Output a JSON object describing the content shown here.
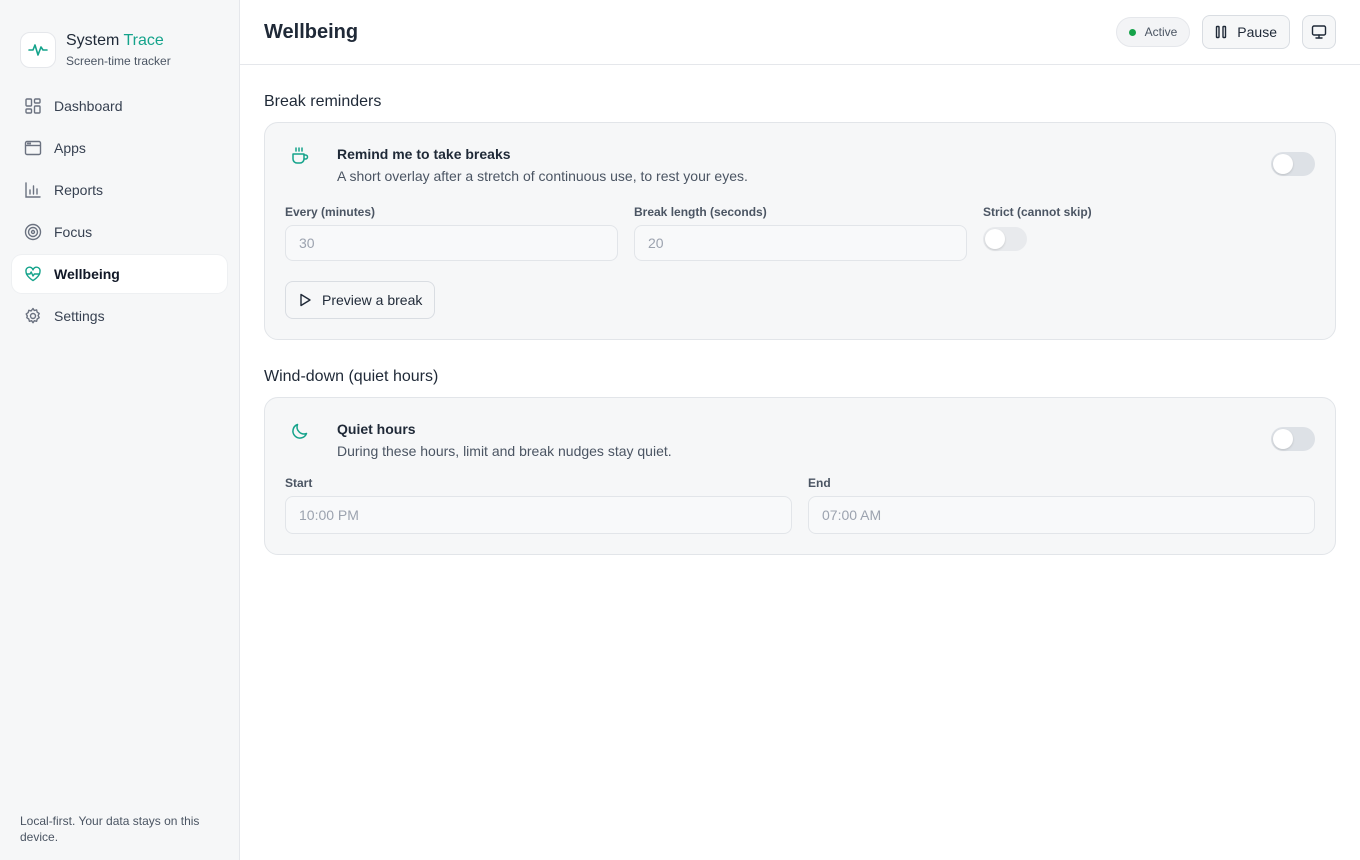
{
  "brand": {
    "name_part1": "System",
    "name_part2": "Trace",
    "subtitle": "Screen-time tracker",
    "accent_color": "#14a38b"
  },
  "sidebar": {
    "items": [
      {
        "label": "Dashboard",
        "icon": "dashboard-icon",
        "active": false
      },
      {
        "label": "Apps",
        "icon": "apps-window-icon",
        "active": false
      },
      {
        "label": "Reports",
        "icon": "bar-chart-icon",
        "active": false
      },
      {
        "label": "Focus",
        "icon": "target-icon",
        "active": false
      },
      {
        "label": "Wellbeing",
        "icon": "heart-pulse-icon",
        "active": true
      },
      {
        "label": "Settings",
        "icon": "gear-icon",
        "active": false
      }
    ],
    "footer": "Local-first. Your data stays on this device."
  },
  "header": {
    "title": "Wellbeing",
    "status": "Active",
    "status_color": "#16a34a",
    "pause_label": "Pause"
  },
  "break_section": {
    "title": "Break reminders",
    "card_title": "Remind me to take breaks",
    "card_desc": "A short overlay after a stretch of continuous use, to rest your eyes.",
    "enabled": false,
    "every_label": "Every (minutes)",
    "every_value": "30",
    "length_label": "Break length (seconds)",
    "length_value": "20",
    "strict_label": "Strict (cannot skip)",
    "strict_enabled": false,
    "preview_label": "Preview a break"
  },
  "quiet_section": {
    "title": "Wind-down (quiet hours)",
    "card_title": "Quiet hours",
    "card_desc": "During these hours, limit and break nudges stay quiet.",
    "enabled": false,
    "start_label": "Start",
    "start_value": "10:00 PM",
    "end_label": "End",
    "end_value": "07:00 AM"
  }
}
